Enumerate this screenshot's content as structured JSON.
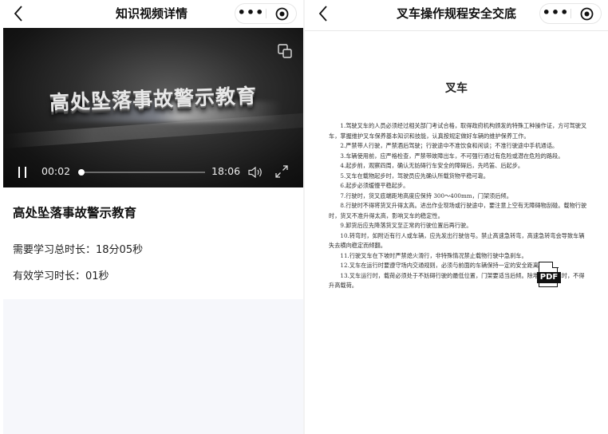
{
  "left": {
    "nav": {
      "title": "知识视频详情",
      "more_label": "•••"
    },
    "video": {
      "overlay_title": "高处坠落事故警示教育",
      "current_time": "00:02",
      "total_time": "18:06",
      "progress_fraction": 0.02
    },
    "course": {
      "title": "高处坠落事故警示教育",
      "required_time": "需要学习总时长：18分05秒",
      "effective_time": "有效学习时长：01秒"
    }
  },
  "right": {
    "nav": {
      "title": "叉车操作规程安全交底",
      "more_label": "•••"
    },
    "document": {
      "heading": "叉车",
      "paragraphs": [
        "1.驾驶叉车的人员必须经过相关部门考试合格，取得政府机构颁发的特殊工种操作证，方可驾驶叉车，掌握维护叉车保养基本知识和技能，认真按规定做好车辆的维护保养工作。",
        "2.严禁带人行驶，严禁酒后驾驶；行驶途中不准饮食和闲谈；不准行驶途中手机通话。",
        "3.车辆使用前，应严格检查，严禁带故障出车，不可强行通过有危险或潜在危险的路段。",
        "4.起步前，观察四周，确认无妨碍行车安全的障碍后，先鸣笛、后起步。",
        "5.叉车在载物起步时，驾驶员应先确认所载货物平稳可靠。",
        "6.起步必须缓慢平稳起步。",
        "7.行驶时，货叉底端距地高度应保持 300～400mm，门架须后倾。",
        "8.行驶时不得将货叉升得太高。进出作业现场或行驶途中，要注意上空有无障碍物刮碰。载物行驶时，货叉不准升得太高，影响叉车的稳定性。",
        "9.卸货后应先降落货叉至正常的行驶位置后再行驶。",
        "10.转弯时，如附近有行人或车辆，应先发出行驶信号。禁止高速急转弯，高速急转弯会导致车辆失去横向稳定而倾翻。",
        "11.行驶叉车在下坡时严禁熄火滑行，非特殊情况禁止载物行驶中急刹车。",
        "12.叉车在运行时要遵守场内交通规则，必须与前面的车辆保持一定的安全距离。",
        "13.叉车运行时，载荷必须处于不妨碍行驶的最低位置，门架要适当后倾。除堆垛或装车时，不得升高载荷。"
      ],
      "attachment_icon_label": "PDF"
    }
  }
}
